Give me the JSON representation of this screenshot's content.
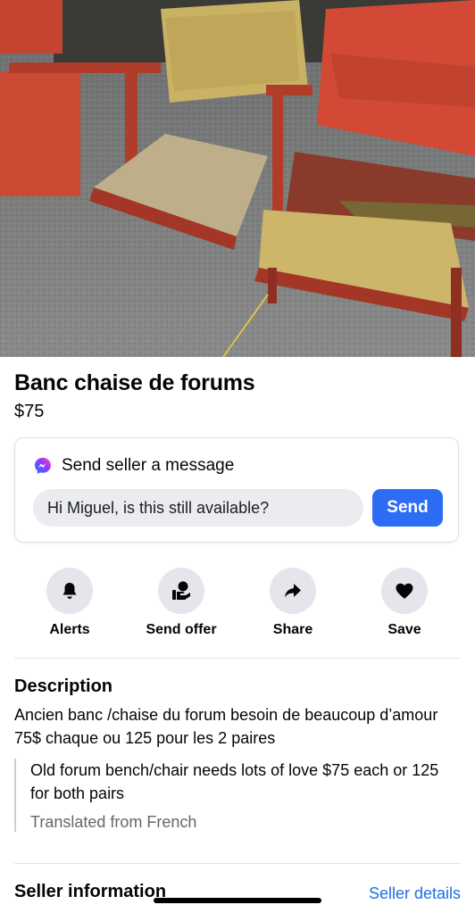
{
  "listing": {
    "photo_alt": "photo",
    "title": "Banc chaise de forums",
    "price": "$75"
  },
  "message": {
    "heading": "Send seller a message",
    "input_value": "Hi Miguel, is this still available?",
    "send_label": "Send",
    "icon": "messenger-icon"
  },
  "actions": [
    {
      "label": "Alerts",
      "icon": "bell-icon"
    },
    {
      "label": "Send offer",
      "icon": "send-offer-icon"
    },
    {
      "label": "Share",
      "icon": "share-icon"
    },
    {
      "label": "Save",
      "icon": "heart-icon"
    }
  ],
  "description": {
    "heading": "Description",
    "text": "Ancien banc /chaise du forum besoin de beaucoup d’amour 75$ chaque ou 125 pour les 2 paires",
    "translation": "Old forum bench/chair needs lots of love $75 each or 125 for both pairs",
    "translation_note": "Translated from French"
  },
  "seller": {
    "heading": "Seller information",
    "details_link": "Seller details"
  },
  "colors": {
    "accent": "#2d6cf5",
    "link": "#1a6fe8",
    "muted": "#65676b"
  }
}
